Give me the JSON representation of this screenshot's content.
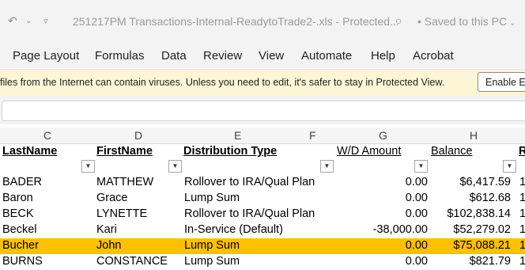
{
  "titlebar": {
    "filename": "251217PM Transactions-Internal-ReadytoTrade2-.xls",
    "mode": "Protected...",
    "saved": "Saved to this PC",
    "undo_icon": "undo-icon",
    "qat_icon": "customize-qat-icon",
    "saved_icon": "cloud-save-icon"
  },
  "menu": {
    "items": [
      "Page Layout",
      "Formulas",
      "Data",
      "Review",
      "View",
      "Automate",
      "Help",
      "Acrobat"
    ]
  },
  "protected_view": {
    "message": "files from the Internet can contain viruses. Unless you need to edit, it's safer to stay in Protected View.",
    "button": "Enable Editing"
  },
  "columns": [
    "C",
    "D",
    "E",
    "F",
    "G",
    "H"
  ],
  "headers": {
    "lastname": "LastName",
    "firstname": "FirstName",
    "distribution": "Distribution Type",
    "wd_amount": "W/D Amount",
    "balance": "Balance",
    "next": "R"
  },
  "rows": [
    {
      "last": "BADER",
      "first": "MATTHEW",
      "type": "Rollover to IRA/Qual Plan",
      "wd": "0.00",
      "balance": "$6,417.59",
      "next": "1"
    },
    {
      "last": "Baron",
      "first": "Grace",
      "type": "Lump Sum",
      "wd": "0.00",
      "balance": "$612.68",
      "next": "1"
    },
    {
      "last": "BECK",
      "first": "LYNETTE",
      "type": "Rollover to IRA/Qual Plan",
      "wd": "0.00",
      "balance": "$102,838.14",
      "next": "1"
    },
    {
      "last": "Beckel",
      "first": "Kari",
      "type": "In-Service (Default)",
      "wd": "-38,000.00",
      "balance": "$52,279.02",
      "next": "1"
    },
    {
      "last": "Bucher",
      "first": "John",
      "type": "Lump Sum",
      "wd": "0.00",
      "balance": "$75,088.21",
      "next": "1"
    },
    {
      "last": "BURNS",
      "first": "CONSTANCE",
      "type": "Lump Sum",
      "wd": "0.00",
      "balance": "$821.79",
      "next": "1"
    }
  ],
  "colors": {
    "selected_row": "#ffc000",
    "protected_bar": "#fdf6d6",
    "chrome": "#f3f3f3"
  }
}
